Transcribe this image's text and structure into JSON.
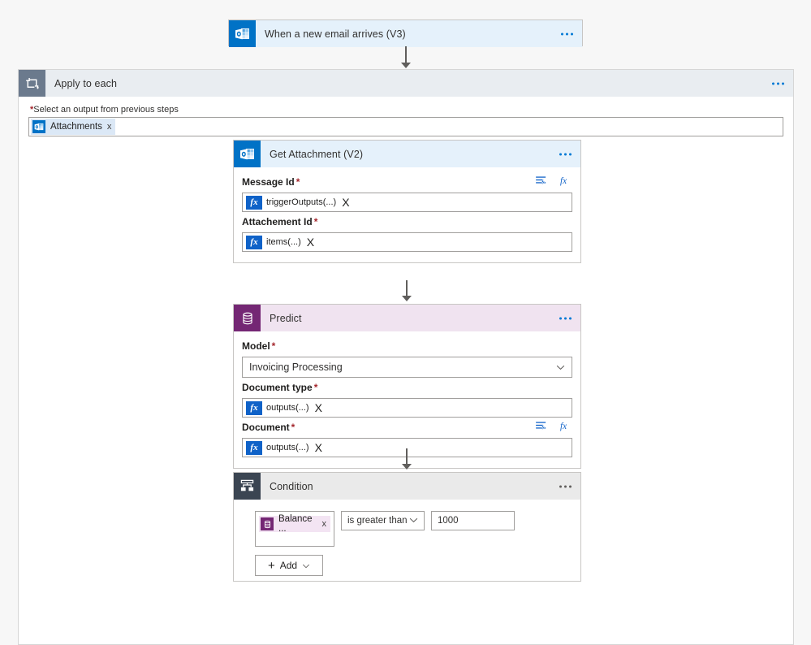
{
  "theme": {
    "page_background": "#f7f7f7",
    "outlook_blue": "#0072c6",
    "outlook_header": "#e5f1fb",
    "ai_purple": "#742774",
    "ai_header": "#f0e3f0",
    "control_grey": "#3b4552",
    "control_header": "#eaeaea",
    "loop_grey": "#6b7a8d",
    "loop_header": "#e9edf1",
    "accent_blue": "#0078d4",
    "required_red": "#a4262c",
    "border_grey": "#a19f9d"
  },
  "trigger": {
    "title": "When a new email arrives (V3)",
    "icon": "outlook-icon",
    "menu_label": "more-commands"
  },
  "apply_to_each": {
    "title": "Apply to each",
    "icon": "loop-icon",
    "menu_label": "more-commands",
    "input_label": "Select an output from previous steps",
    "required_marker": "*",
    "token": {
      "label": "Attachments",
      "icon": "outlook-icon",
      "remove_label": "x"
    }
  },
  "get_attachment": {
    "title": "Get Attachment (V2)",
    "icon": "outlook-icon",
    "menu_label": "more-commands",
    "fields": [
      {
        "label": "Message Id",
        "required_marker": "*",
        "value": "triggerOutputs(...)",
        "token_badge": "fx",
        "remove_label": "X",
        "has_actions": true,
        "actions": [
          "dynamic-content-icon",
          "expression-fx-icon"
        ]
      },
      {
        "label": "Attachement Id",
        "required_marker": "*",
        "value": "items(...)",
        "token_badge": "fx",
        "remove_label": "X",
        "has_actions": false,
        "actions": []
      }
    ]
  },
  "predict": {
    "title": "Predict",
    "icon": "ai-model-icon",
    "menu_label": "more-commands",
    "model_field": {
      "label": "Model",
      "required_marker": "*",
      "value": "Invoicing Processing",
      "chevron": "chevron-down-icon"
    },
    "fields": [
      {
        "label": "Document type",
        "required_marker": "*",
        "value": "outputs(...)",
        "token_badge": "fx",
        "remove_label": "X",
        "has_actions": false,
        "actions": []
      },
      {
        "label": "Document",
        "required_marker": "*",
        "value": "outputs(...)",
        "token_badge": "fx",
        "remove_label": "X",
        "has_actions": true,
        "actions": [
          "dynamic-content-icon",
          "expression-fx-icon"
        ]
      }
    ]
  },
  "condition": {
    "title": "Condition",
    "icon": "condition-branch-icon",
    "menu_label": "more-commands",
    "row": {
      "token": {
        "label": "Balance ...",
        "icon": "ai-model-icon",
        "remove_label": "x"
      },
      "operator": "is greater than",
      "operator_chevron": "chevron-down-icon",
      "value": "1000"
    },
    "add_button": {
      "label": "Add",
      "plus": "+",
      "chevron": "chevron-down-icon"
    }
  }
}
